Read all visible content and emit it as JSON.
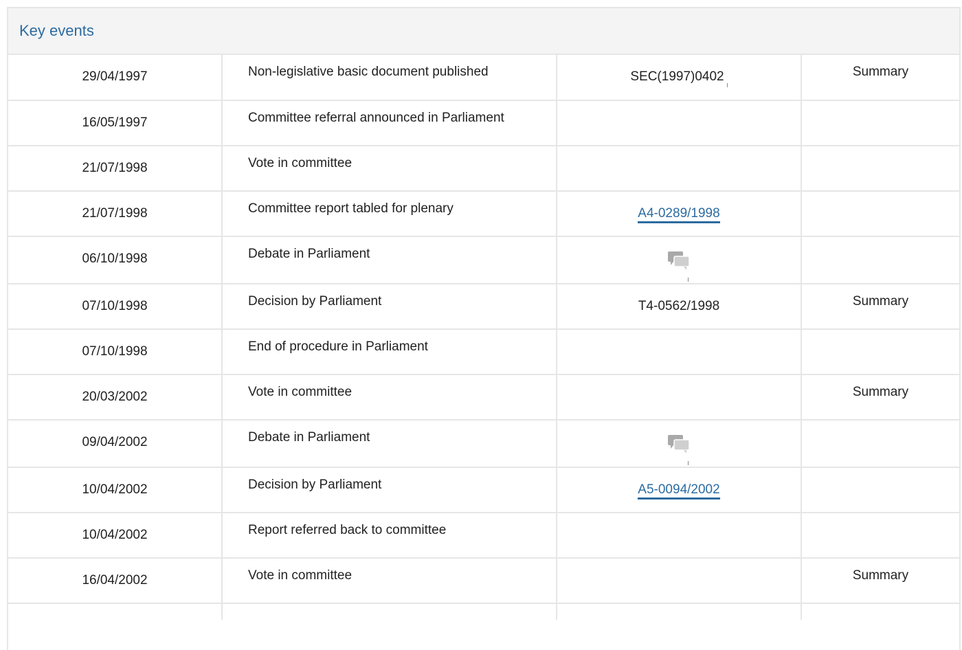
{
  "panel": {
    "title": "Key events"
  },
  "events": [
    {
      "date": "29/04/1997",
      "event": "Non-legislative basic document published",
      "ref": "SEC(1997)0402",
      "ref_type": "text",
      "summary": "Summary"
    },
    {
      "date": "16/05/1997",
      "event": "Committee referral announced in Parliament",
      "ref": "",
      "ref_type": "none",
      "summary": ""
    },
    {
      "date": "21/07/1998",
      "event": "Vote in committee",
      "ref": "",
      "ref_type": "none",
      "summary": ""
    },
    {
      "date": "21/07/1998",
      "event": "Committee report tabled for plenary",
      "ref": "A4-0289/1998",
      "ref_type": "link",
      "summary": ""
    },
    {
      "date": "06/10/1998",
      "event": "Debate in Parliament",
      "ref": "",
      "ref_type": "debate",
      "summary": ""
    },
    {
      "date": "07/10/1998",
      "event": "Decision by Parliament",
      "ref": "T4-0562/1998",
      "ref_type": "plain",
      "summary": "Summary"
    },
    {
      "date": "07/10/1998",
      "event": "End of procedure in Parliament",
      "ref": "",
      "ref_type": "none",
      "summary": ""
    },
    {
      "date": "20/03/2002",
      "event": "Vote in committee",
      "ref": "",
      "ref_type": "none",
      "summary": "Summary"
    },
    {
      "date": "09/04/2002",
      "event": "Debate in Parliament",
      "ref": "",
      "ref_type": "debate",
      "summary": ""
    },
    {
      "date": "10/04/2002",
      "event": "Decision by Parliament",
      "ref": "A5-0094/2002",
      "ref_type": "link",
      "summary": ""
    },
    {
      "date": "10/04/2002",
      "event": "Report referred back to committee",
      "ref": "",
      "ref_type": "none",
      "summary": ""
    },
    {
      "date": "16/04/2002",
      "event": "Vote in committee",
      "ref": "",
      "ref_type": "none",
      "summary": "Summary"
    }
  ],
  "icons": {
    "debate": "debate-speech-bubbles-icon"
  },
  "colors": {
    "link": "#2c6ba0",
    "border": "#e6e6e6",
    "header_bg": "#f4f4f4"
  }
}
